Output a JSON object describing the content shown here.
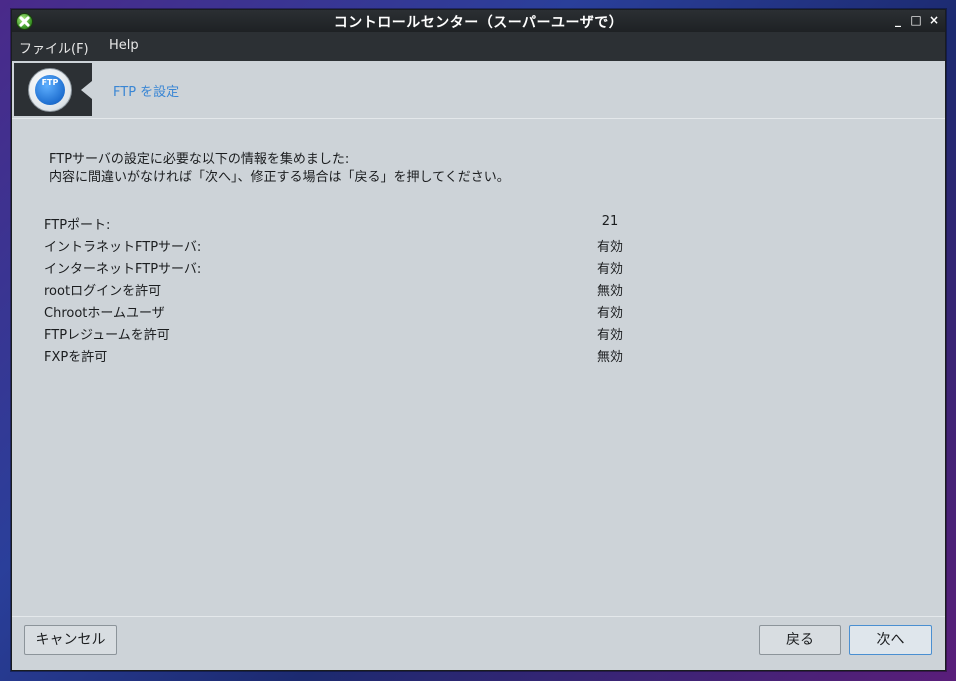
{
  "window": {
    "title": "コントロールセンター（スーパーユーザで）",
    "controls": {
      "minimize": "_",
      "maximize": "□",
      "close": "×"
    }
  },
  "menu": {
    "file": "ファイル(F)",
    "help": "Help"
  },
  "header": {
    "icon_text": "FTP",
    "title": "FTP を設定"
  },
  "intro": {
    "line1": "FTPサーバの設定に必要な以下の情報を集めました:",
    "line2": "内容に間違いがなければ「次へ」、修正する場合は「戻る」を押してください。"
  },
  "settings": [
    {
      "label": "FTPポート:",
      "value": "21"
    },
    {
      "label": "イントラネットFTPサーバ:",
      "value": "有効"
    },
    {
      "label": "インターネットFTPサーバ:",
      "value": "有効"
    },
    {
      "label": "rootログインを許可",
      "value": "無効"
    },
    {
      "label": "Chrootホームユーザ",
      "value": "有効"
    },
    {
      "label": "FTPレジュームを許可",
      "value": "有効"
    },
    {
      "label": "FXPを許可",
      "value": "無効"
    }
  ],
  "buttons": {
    "cancel": "キャンセル",
    "back": "戻る",
    "next": "次へ"
  }
}
